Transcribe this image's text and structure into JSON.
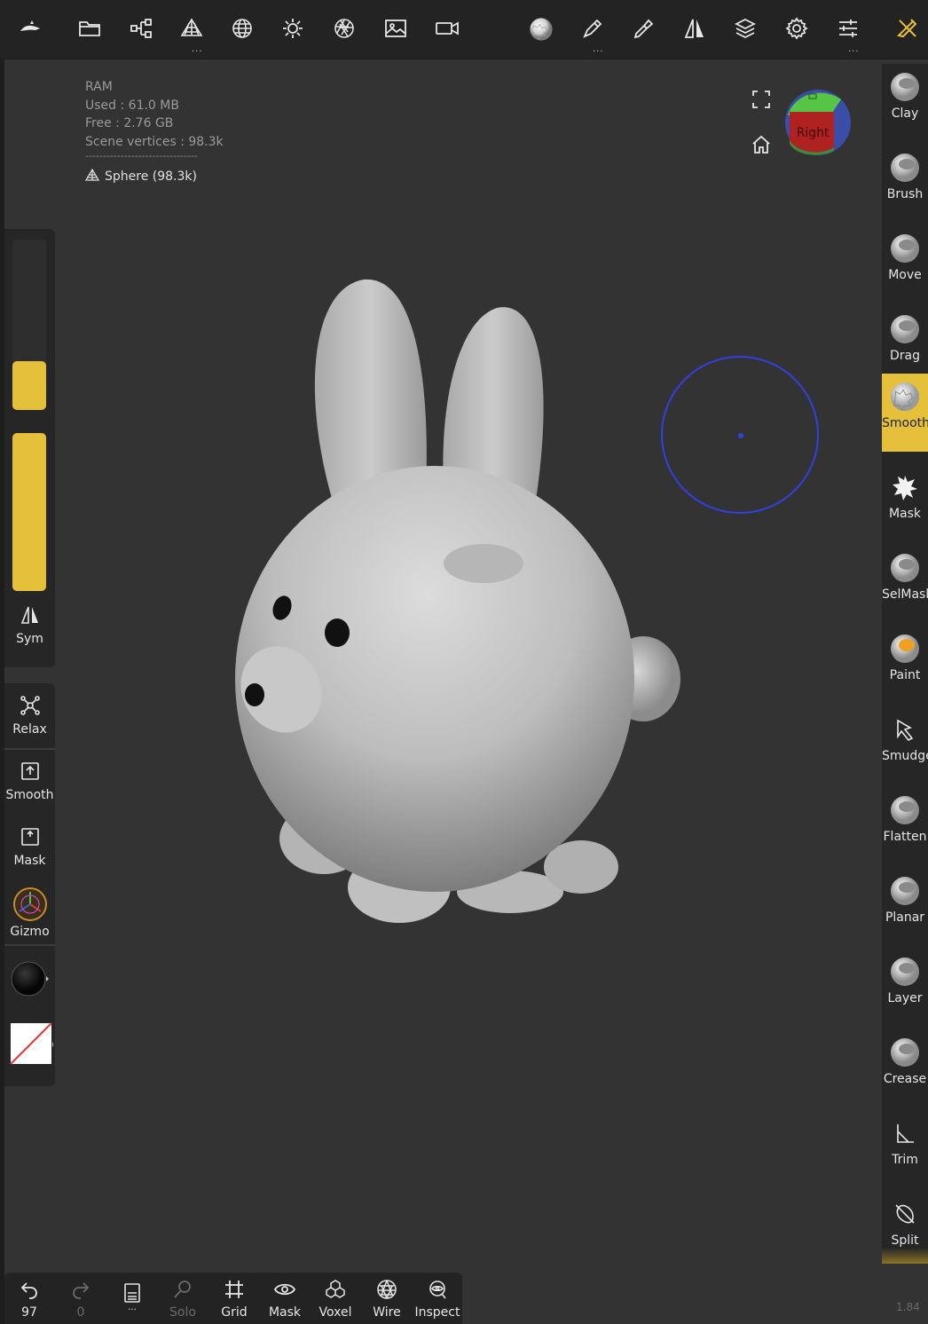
{
  "stats": {
    "ram_label": "RAM",
    "used": "Used : 61.0 MB",
    "free": "Free : 2.76 GB",
    "scene_vertices": "Scene vertices : 98.3k",
    "separator": "--------------------------------",
    "mesh_name": "Sphere (98.3k)"
  },
  "viewcube": {
    "face_label": "Right"
  },
  "left_panel": {
    "sym_label": "Sym",
    "tools": [
      {
        "label": "Relax",
        "icon": "relax-icon"
      },
      {
        "label": "Smooth",
        "icon": "smooth-icon"
      },
      {
        "label": "Mask",
        "icon": "mask-icon"
      },
      {
        "label": "Gizmo",
        "icon": "gizmo-icon"
      }
    ],
    "slider_radius_level": 0.4,
    "slider_intensity_level": 1.0
  },
  "right_panel": {
    "tools": [
      {
        "label": "Clay"
      },
      {
        "label": "Brush"
      },
      {
        "label": "Move"
      },
      {
        "label": "Drag"
      },
      {
        "label": "Smooth",
        "active": true
      },
      {
        "label": "Mask"
      },
      {
        "label": "SelMask"
      },
      {
        "label": "Paint"
      },
      {
        "label": "Smudge"
      },
      {
        "label": "Flatten"
      },
      {
        "label": "Planar"
      },
      {
        "label": "Layer"
      },
      {
        "label": "Crease"
      },
      {
        "label": "Trim"
      },
      {
        "label": "Split"
      }
    ]
  },
  "bottom_bar": {
    "undo_count": "97",
    "redo_count": "0",
    "menu_dots": "...",
    "solo": "Solo",
    "grid": "Grid",
    "mask": "Mask",
    "voxel": "Voxel",
    "wire": "Wire",
    "inspect": "Inspect"
  },
  "version": "1.84",
  "colors": {
    "accent": "#e5c03a",
    "brush_circle": "#3340e0",
    "background": "#333333",
    "panel": "#262626"
  }
}
